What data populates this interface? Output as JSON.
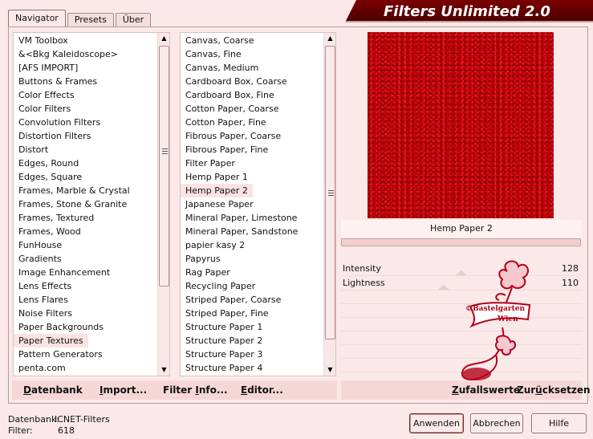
{
  "tabs": [
    {
      "label": "Navigator",
      "active": true
    },
    {
      "label": "Presets",
      "active": false
    },
    {
      "label": "Über",
      "active": false
    }
  ],
  "brand": {
    "title": "Filters Unlimited 2.0"
  },
  "categories": {
    "items": [
      "VM Toolbox",
      "&<Bkg Kaleidoscope>",
      "[AFS IMPORT]",
      "Buttons & Frames",
      "Color Effects",
      "Color Filters",
      "Convolution Filters",
      "Distortion Filters",
      "Distort",
      "Edges, Round",
      "Edges, Square",
      "Frames, Marble & Crystal",
      "Frames, Stone & Granite",
      "Frames, Textured",
      "Frames, Wood",
      "FunHouse",
      "Gradients",
      "Image Enhancement",
      "Lens Effects",
      "Lens Flares",
      "Noise Filters",
      "Paper Backgrounds",
      "Paper Textures",
      "Pattern Generators",
      "penta.com"
    ],
    "selected": "Paper Textures"
  },
  "filters": {
    "items": [
      "Canvas, Coarse",
      "Canvas, Fine",
      "Canvas, Medium",
      "Cardboard Box, Coarse",
      "Cardboard Box, Fine",
      "Cotton Paper, Coarse",
      "Cotton Paper, Fine",
      "Fibrous Paper, Coarse",
      "Fibrous Paper, Fine",
      "Filter Paper",
      "Hemp Paper 1",
      "Hemp Paper 2",
      "Japanese Paper",
      "Mineral Paper, Limestone",
      "Mineral Paper, Sandstone",
      "papier kasy 2",
      "Papyrus",
      "Rag Paper",
      "Recycling Paper",
      "Striped Paper, Coarse",
      "Striped Paper, Fine",
      "Structure Paper 1",
      "Structure Paper 2",
      "Structure Paper 3",
      "Structure Paper 4"
    ],
    "selected": "Hemp Paper 2"
  },
  "toolbar": {
    "datenbank_u": "D",
    "datenbank_rest": "atenbank",
    "import_u": "I",
    "import_rest": "mport...",
    "filterinfo_pre": "Filter ",
    "filterinfo_u": "I",
    "filterinfo_rest": "nfo...",
    "editor_u": "E",
    "editor_rest": "ditor..."
  },
  "preview": {
    "filter_name": "Hemp Paper 2",
    "accent": "#c40008"
  },
  "params": [
    {
      "label": "Intensity",
      "value": "128"
    },
    {
      "label": "Lightness",
      "value": "110"
    }
  ],
  "rightbar": {
    "zufall_u": "Z",
    "zufall_rest": "ufallswerte",
    "reset_pre": "Zur",
    "reset_u": "ü",
    "reset_rest": "cksetzen"
  },
  "logo": {
    "line1": "©Bastelgarten",
    "line2": "Wien"
  },
  "status": {
    "db_label": "Datenbank:",
    "db_value": "ICNET-Filters",
    "filter_label": "Filter:",
    "filter_value": "618"
  },
  "buttons": {
    "apply": "Anwenden",
    "cancel": "Abbrechen",
    "help": "Hilfe"
  }
}
